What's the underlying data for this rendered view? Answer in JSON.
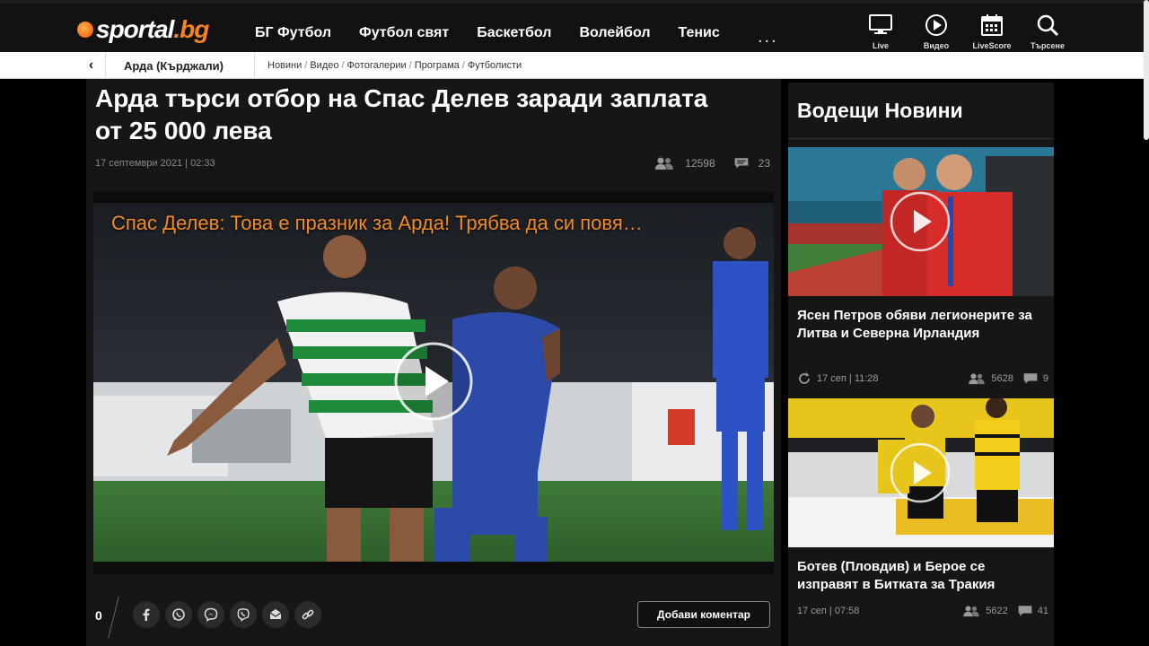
{
  "logo": {
    "name": "sportal",
    "suffix": ".bg"
  },
  "nav": {
    "items": [
      "БГ Футбол",
      "Футбол свят",
      "Баскетбол",
      "Волейбол",
      "Тенис"
    ],
    "more": "..."
  },
  "utils": [
    {
      "label": "Live",
      "icon": "monitor-icon"
    },
    {
      "label": "Видео",
      "icon": "play-circle-icon"
    },
    {
      "label": "LiveScore",
      "icon": "calendar-icon"
    },
    {
      "label": "Търсене",
      "icon": "search-icon"
    }
  ],
  "breadcrumb": {
    "club": "Арда (Кърджали)",
    "links": [
      "Новини",
      "Видео",
      "Фотогалерии",
      "Програма",
      "Футболисти"
    ]
  },
  "article": {
    "title": "Арда търси отбор на Спас Делев заради заплата от 25 000 лева",
    "date": "17 септември 2021 | 02:33",
    "views": "12598",
    "comments": "23",
    "video_caption": "Спас Делев: Това е празник за Арда! Трябва да си повя…",
    "share_count": "0",
    "comment_button": "Добави коментар"
  },
  "sidebar": {
    "title": "Водещи Новини",
    "stories": [
      {
        "title": "Ясен Петров обяви легионерите за Литва и Северна Ирландия",
        "date": "17 сеп | 11:28",
        "views": "5628",
        "comments": "9"
      },
      {
        "title": "Ботев (Пловдив) и Берое се изправят в Битката за Тракия",
        "date": "17 сеп | 07:58",
        "views": "5622",
        "comments": "41"
      }
    ]
  },
  "colors": {
    "accent": "#f58220",
    "background": "#000000",
    "panel": "#161616"
  }
}
